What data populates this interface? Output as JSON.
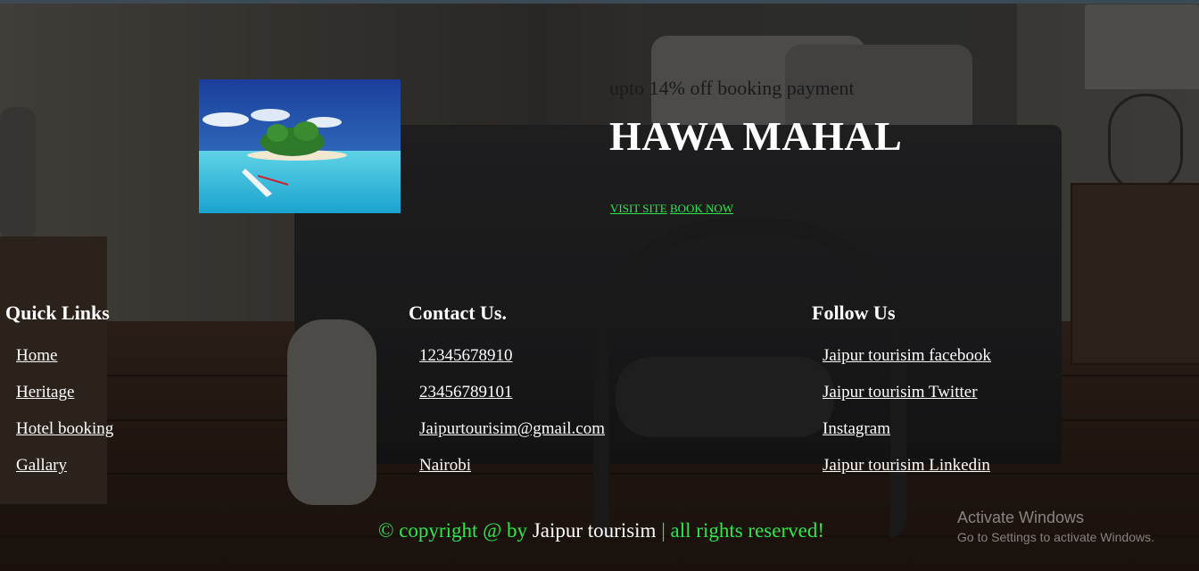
{
  "hero": {
    "promo_text": "upto 14% off booking payment",
    "title": "HAWA MAHAL",
    "links": [
      "VISIT SITE",
      "BOOK NOW"
    ]
  },
  "footer": {
    "columns": [
      {
        "heading": "Quick Links",
        "items": [
          "Home",
          "Heritage",
          "Hotel booking",
          "Gallary"
        ]
      },
      {
        "heading": "Contact Us.",
        "items": [
          "12345678910",
          "23456789101",
          "Jaipurtourisim@gmail.com",
          "Nairobi"
        ]
      },
      {
        "heading": "Follow Us",
        "items": [
          "Jaipur tourisim facebook",
          "Jaipur tourisim Twitter",
          "Instagram",
          "Jaipur tourisim Linkedin"
        ]
      }
    ],
    "copyright_prefix": "© copyright @ by",
    "copyright_brand": "Jaipur tourisim",
    "copyright_suffix": "| all rights reserved!"
  },
  "watermark": {
    "line1": "Activate Windows",
    "line2": "Go to Settings to activate Windows."
  },
  "colors": {
    "link_green": "#2ee84a",
    "text_white": "#ffffff"
  }
}
